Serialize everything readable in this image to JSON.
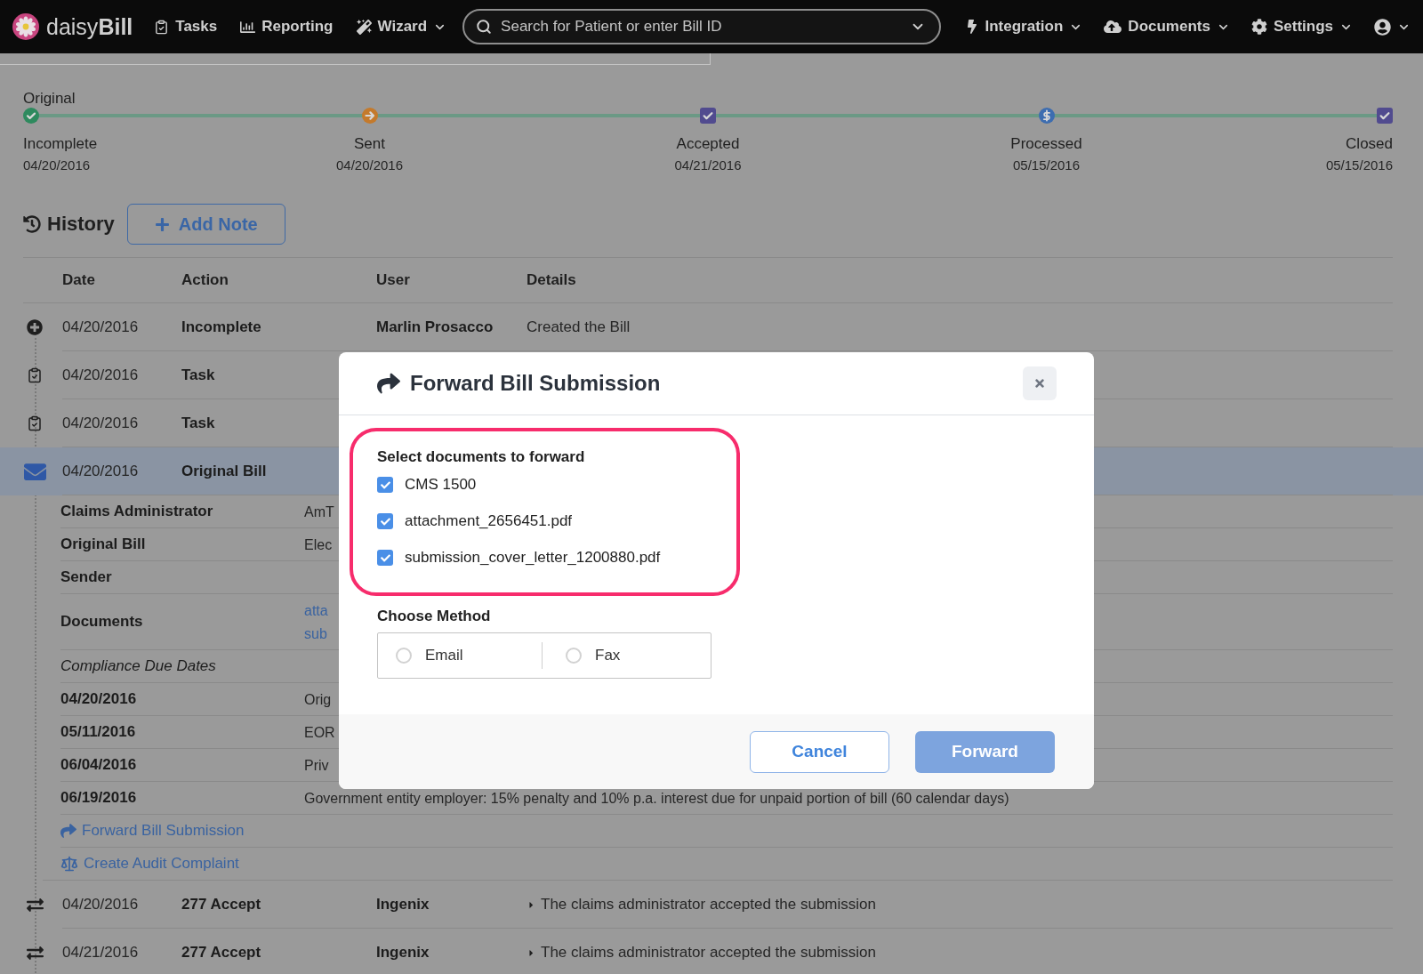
{
  "nav": {
    "logo": "daisy**Bill**",
    "items_left": [
      {
        "kind": "tasks",
        "label": "Tasks",
        "dropdown": false
      },
      {
        "kind": "reporting",
        "label": "Reporting",
        "dropdown": false
      },
      {
        "kind": "wizard",
        "label": "Wizard",
        "dropdown": true
      }
    ],
    "search": {
      "placeholder": "Search for Patient or enter Bill ID"
    },
    "items_right": [
      {
        "kind": "integration",
        "label": "Integration",
        "dropdown": true
      },
      {
        "kind": "documents",
        "label": "Documents",
        "dropdown": true
      },
      {
        "kind": "settings",
        "label": "Settings",
        "dropdown": true
      },
      {
        "kind": "account",
        "dropdown": true
      }
    ]
  },
  "tracker": {
    "title": "Original",
    "steps": [
      {
        "kind": "check",
        "label": "Incomplete",
        "date": "04/20/2016",
        "color": "#2e8a5e"
      },
      {
        "kind": "arrow",
        "label": "Sent",
        "date": "04/20/2016",
        "color": "#c47a2c"
      },
      {
        "kind": "box",
        "label": "Accepted",
        "date": "04/21/2016",
        "color": "#514b8f"
      },
      {
        "kind": "dollar",
        "label": "Processed",
        "date": "05/15/2016",
        "color": "#3d6db0"
      },
      {
        "kind": "box",
        "label": "Closed",
        "date": "05/15/2016",
        "color": "#514b8f"
      }
    ]
  },
  "history": {
    "title": "History",
    "add_button": "Add Note",
    "columns": [
      "Date",
      "Action",
      "User",
      "Details"
    ],
    "rows": [
      {
        "kind": "created",
        "date": "04/20/2016",
        "action": "Incomplete",
        "user": "Marlin Prosacco",
        "details": "Created the Bill",
        "selected": false
      },
      {
        "kind": "task",
        "date": "04/20/2016",
        "action": "Task",
        "selected": false
      },
      {
        "kind": "task",
        "date": "04/20/2016",
        "action": "Task",
        "selected": false
      },
      {
        "kind": "bill",
        "date": "04/20/2016",
        "action": "Original Bill",
        "selected": true,
        "expanded": true,
        "fields": [
          {
            "label": "Claims Administrator",
            "value": "AmT"
          },
          {
            "label": "Original Bill",
            "value": "Elec"
          },
          {
            "label": "Sender"
          },
          {
            "label": "Documents",
            "links": [
              "atta",
              "sub"
            ]
          }
        ],
        "due_dates_title": "Compliance Due Dates",
        "due_dates": [
          {
            "date": "04/20/2016",
            "text": "Orig"
          },
          {
            "date": "05/11/2016",
            "text": "EOR"
          },
          {
            "date": "06/04/2016",
            "text": "Priv"
          },
          {
            "date": "06/19/2016",
            "text": "Government entity employer: 15% penalty and 10% p.a. interest due for unpaid portion of bill (60 calendar days)"
          }
        ],
        "actions": [
          {
            "kind": "forward",
            "label": "Forward Bill Submission"
          },
          {
            "kind": "audit",
            "label": "Create Audit Complaint"
          }
        ]
      },
      {
        "kind": "edi",
        "date": "04/20/2016",
        "action": "277 Accept",
        "user": "Ingenix",
        "details": "The claims administrator accepted the submission",
        "expanded": false,
        "selected": false
      },
      {
        "kind": "edi",
        "date": "04/21/2016",
        "action": "277 Accept",
        "user": "Ingenix",
        "details": "The claims administrator accepted the submission",
        "expanded": false,
        "selected": false
      }
    ]
  },
  "modal": {
    "title": "Forward Bill Submission",
    "documents_label": "Select documents to forward",
    "documents": [
      {
        "label": "CMS 1500",
        "checked": true
      },
      {
        "label": "attachment_2656451.pdf",
        "checked": true
      },
      {
        "label": "submission_cover_letter_1200880.pdf",
        "checked": true
      }
    ],
    "method_label": "Choose Method",
    "methods": [
      {
        "label": "Email",
        "selected": false
      },
      {
        "label": "Fax",
        "selected": false
      }
    ],
    "buttons": [
      {
        "kind": "cancel",
        "label": "Cancel",
        "disabled": false
      },
      {
        "kind": "forward",
        "label": "Forward",
        "disabled": true
      }
    ]
  }
}
